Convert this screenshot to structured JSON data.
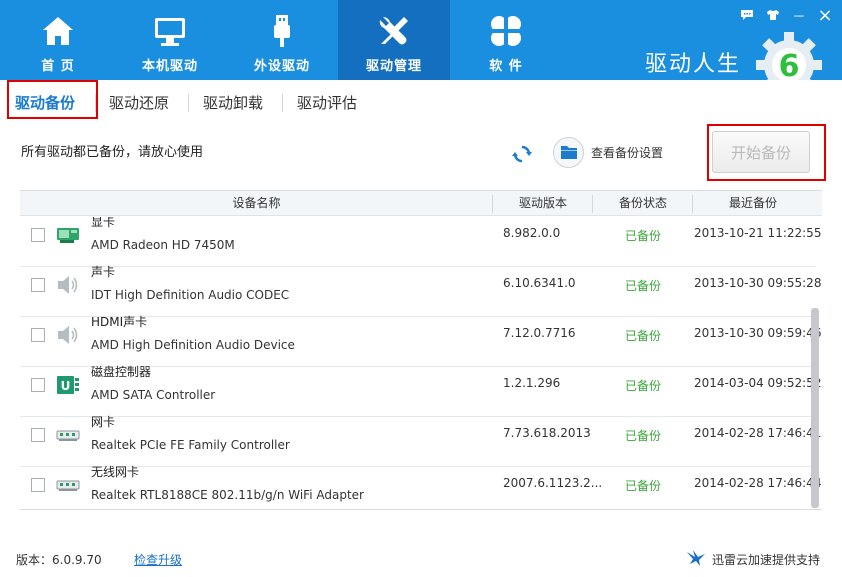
{
  "header": {
    "nav": [
      {
        "label": "首 页",
        "icon": "home-icon"
      },
      {
        "label": "本机驱动",
        "icon": "monitor-icon"
      },
      {
        "label": "外设驱动",
        "icon": "usb-icon"
      },
      {
        "label": "驱动管理",
        "icon": "tools-icon",
        "active": true
      },
      {
        "label": "软 件",
        "icon": "apps-icon"
      }
    ],
    "brand": "驱动人生",
    "logo_digit": "6",
    "accent": "#1b8fdf",
    "active_color": "#146fc0"
  },
  "window_controls": {
    "feedback": "feedback-icon",
    "skin": "skin-icon",
    "minimize": "－",
    "close": "×"
  },
  "subtabs": [
    {
      "label": "驱动备份",
      "active": true
    },
    {
      "label": "驱动还原"
    },
    {
      "label": "驱动卸载"
    },
    {
      "label": "驱动评估"
    }
  ],
  "toolbar": {
    "message": "所有驱动都已备份，请放心使用",
    "settings_label": "查看备份设置",
    "start_label": "开始备份"
  },
  "table": {
    "columns": [
      "设备名称",
      "驱动版本",
      "备份状态",
      "最近备份"
    ],
    "rows": [
      {
        "category": "显卡",
        "name": "AMD Radeon HD 7450M",
        "version": "8.982.0.0",
        "status": "已备份",
        "date": "2013-10-21 11:22:55",
        "icon": "graphics-card-icon"
      },
      {
        "category": "声卡",
        "name": "IDT High Definition Audio CODEC",
        "version": "6.10.6341.0",
        "status": "已备份",
        "date": "2013-10-30 09:55:28",
        "icon": "speaker-icon"
      },
      {
        "category": "HDMI声卡",
        "name": "AMD High Definition Audio Device",
        "version": "7.12.0.7716",
        "status": "已备份",
        "date": "2013-10-30 09:59:46",
        "icon": "speaker-icon"
      },
      {
        "category": "磁盘控制器",
        "name": "AMD SATA Controller",
        "version": "1.2.1.296",
        "status": "已备份",
        "date": "2014-03-04 09:52:52",
        "icon": "disk-controller-icon"
      },
      {
        "category": "网卡",
        "name": "Realtek PCIe FE Family Controller",
        "version": "7.73.618.2013",
        "status": "已备份",
        "date": "2014-02-28 17:46:41",
        "icon": "network-card-icon"
      },
      {
        "category": "无线网卡",
        "name": "Realtek RTL8188CE 802.11b/g/n WiFi Adapter",
        "version": "2007.6.1123.2...",
        "status": "已备份",
        "date": "2014-02-28 17:46:44",
        "icon": "network-card-icon"
      }
    ],
    "status_color": "#3aa63a"
  },
  "footer": {
    "version": "版本：6.0.9.70",
    "upgrade_link": "检查升级",
    "support": "迅雷云加速提供支持"
  }
}
